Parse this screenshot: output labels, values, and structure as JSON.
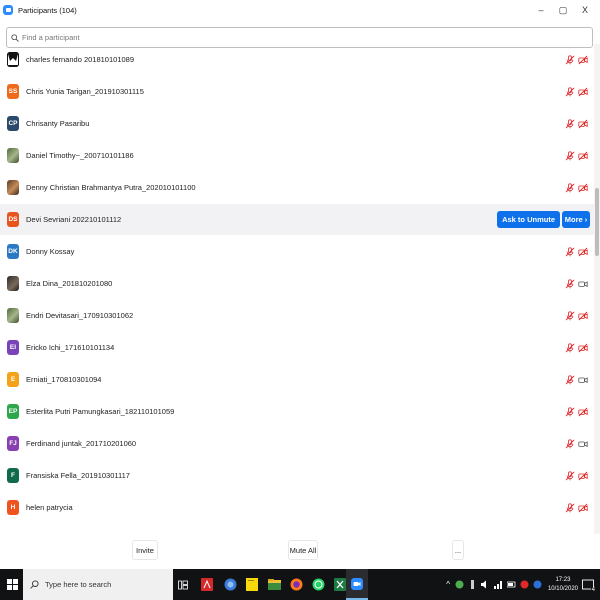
{
  "window": {
    "title": "Participants (104)",
    "minimize_glyph": "–",
    "restore_glyph": "▢",
    "close_glyph": "X"
  },
  "search": {
    "placeholder": "Find a participant"
  },
  "participants": [
    {
      "name": "charles fernando 201810101089",
      "initials": "",
      "avatar_kind": "photo-black",
      "color": "#141414",
      "mic": "muted",
      "cam": "off"
    },
    {
      "name": "Chris Yunia Tarigan_201910301115",
      "initials": "SS",
      "avatar_kind": "initials",
      "color": "#ef6a1a",
      "mic": "muted",
      "cam": "off"
    },
    {
      "name": "Chrisanty Pasaribu",
      "initials": "CP",
      "avatar_kind": "initials",
      "color": "#2a4a6b",
      "mic": "muted",
      "cam": "off"
    },
    {
      "name": "Daniel Timothy~_200710101186",
      "initials": "",
      "avatar_kind": "photo-green",
      "color": "#6b7f4a",
      "mic": "muted",
      "cam": "off"
    },
    {
      "name": "Denny Christian Brahmantya Putra_202010101100",
      "initials": "",
      "avatar_kind": "photo-warm",
      "color": "#8a5a34",
      "mic": "muted",
      "cam": "off"
    },
    {
      "name": "Devi Sevriani 202210101112",
      "initials": "DS",
      "avatar_kind": "initials",
      "color": "#e8541e",
      "mic": "none",
      "cam": "none",
      "hover": true
    },
    {
      "name": "Donny Kossay",
      "initials": "DK",
      "avatar_kind": "initials",
      "color": "#2b79c4",
      "mic": "muted",
      "cam": "off"
    },
    {
      "name": "Elza Dina_201810201080",
      "initials": "",
      "avatar_kind": "photo-dark",
      "color": "#4a3c30",
      "mic": "muted",
      "cam": "on"
    },
    {
      "name": "Endri Devitasari_170910301062",
      "initials": "",
      "avatar_kind": "photo-green",
      "color": "#3d4a2c",
      "mic": "muted",
      "cam": "off"
    },
    {
      "name": "Ericko Ichi_171610101134",
      "initials": "EI",
      "avatar_kind": "initials",
      "color": "#7a44b8",
      "mic": "muted",
      "cam": "off"
    },
    {
      "name": "Erniati_170810301094",
      "initials": "E",
      "avatar_kind": "initials",
      "color": "#f5a21b",
      "mic": "muted",
      "cam": "on"
    },
    {
      "name": "Esterlita Putri Pamungkasari_182110101059",
      "initials": "EP",
      "avatar_kind": "initials",
      "color": "#2ea84a",
      "mic": "muted",
      "cam": "off"
    },
    {
      "name": "Ferdinand juntak_201710201060",
      "initials": "FJ",
      "avatar_kind": "initials",
      "color": "#8a3fb0",
      "mic": "muted",
      "cam": "on"
    },
    {
      "name": "Fransiska Fella_201910301117",
      "initials": "F",
      "avatar_kind": "initials",
      "color": "#0f6b4c",
      "mic": "muted",
      "cam": "off"
    },
    {
      "name": "helen patrycia",
      "initials": "H",
      "avatar_kind": "initials",
      "color": "#f0541e",
      "mic": "muted",
      "cam": "off"
    }
  ],
  "row_actions": {
    "ask_to_unmute": "Ask to Unmute",
    "more": "More ›"
  },
  "footer": {
    "invite": "Invite",
    "mute_all": "Mute All",
    "more": "..."
  },
  "taskbar": {
    "search_placeholder": "Type here to search",
    "time": "17:23",
    "date": "10/10/2020",
    "notification_count": "4"
  },
  "colors": {
    "accent": "#0e71eb",
    "muted_red": "#e02828",
    "cam_grey": "#555555",
    "taskbar": "#111214"
  }
}
